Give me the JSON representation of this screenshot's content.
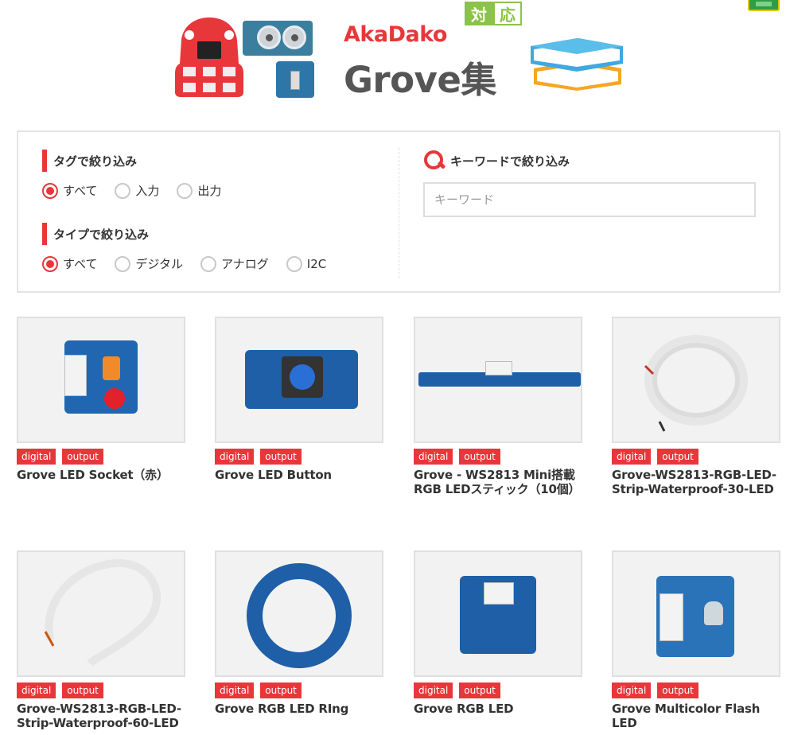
{
  "header": {
    "brand_name": "AkaDako",
    "badge_1": "対",
    "badge_2": "応",
    "title": "Grove集"
  },
  "filters": {
    "tag": {
      "title": "タグで絞り込み",
      "options": [
        "すべて",
        "入力",
        "出力"
      ],
      "selected": "すべて"
    },
    "type": {
      "title": "タイプで絞り込み",
      "options": [
        "すべて",
        "デジタル",
        "アナログ",
        "I2C"
      ],
      "selected": "すべて"
    },
    "keyword": {
      "title": "キーワードで絞り込み",
      "placeholder": "キーワード",
      "value": ""
    }
  },
  "products": [
    {
      "title": "Grove LED Socket（赤）",
      "tags": [
        "digital",
        "output"
      ]
    },
    {
      "title": "Grove LED Button",
      "tags": [
        "digital",
        "output"
      ]
    },
    {
      "title": "Grove - WS2813 Mini搭載RGB LEDスティック（10個）",
      "tags": [
        "digital",
        "output"
      ]
    },
    {
      "title": "Grove-WS2813-RGB-LED-Strip-Waterproof-30-LED",
      "tags": [
        "digital",
        "output"
      ]
    },
    {
      "title": "Grove-WS2813-RGB-LED-Strip-Waterproof-60-LED",
      "tags": [
        "digital",
        "output"
      ]
    },
    {
      "title": "Grove RGB LED RIng",
      "tags": [
        "digital",
        "output"
      ]
    },
    {
      "title": "Grove RGB LED",
      "tags": [
        "digital",
        "output"
      ]
    },
    {
      "title": "Grove Multicolor Flash LED",
      "tags": [
        "digital",
        "output"
      ]
    }
  ],
  "colors": {
    "accent": "#e8373a",
    "badge_green": "#8bc34a",
    "pcb_blue": "#1e5fa8"
  }
}
